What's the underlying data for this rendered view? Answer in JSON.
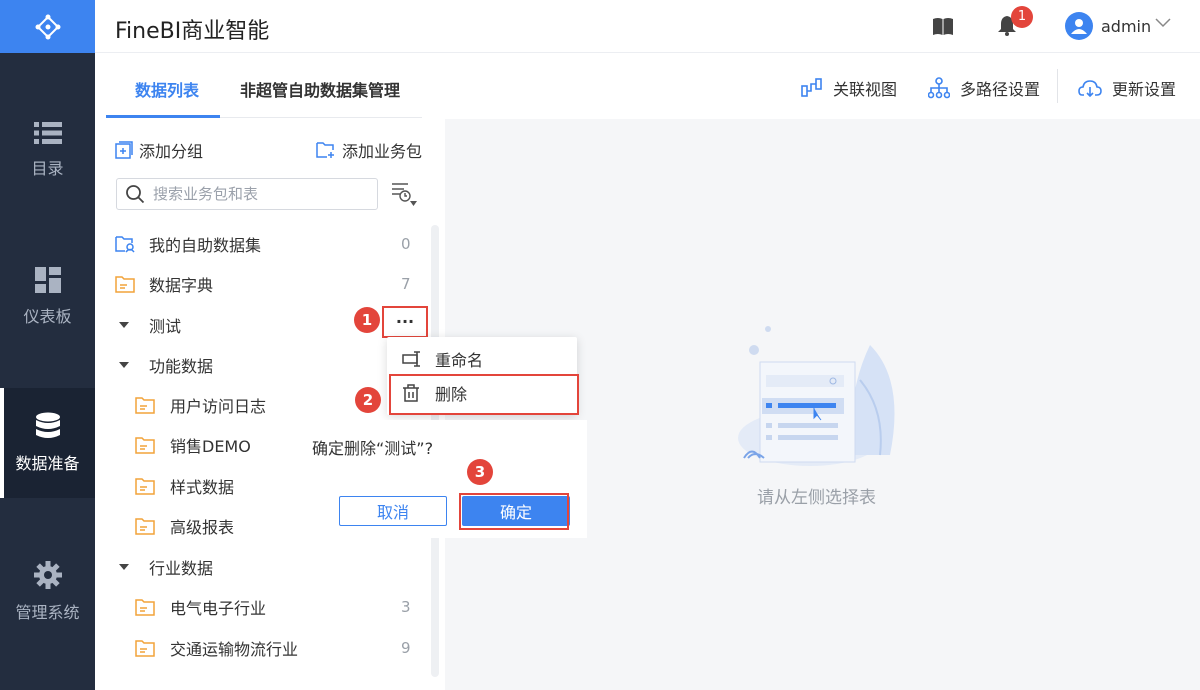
{
  "app": {
    "title": "FineBI商业智能"
  },
  "header": {
    "notification_count": "1",
    "username": "admin"
  },
  "nav": {
    "items": [
      {
        "label": "目录",
        "icon": "list-icon"
      },
      {
        "label": "仪表板",
        "icon": "dashboard-icon"
      },
      {
        "label": "数据准备",
        "icon": "database-icon",
        "active": true
      },
      {
        "label": "管理系统",
        "icon": "gear-icon"
      }
    ]
  },
  "tabs": [
    {
      "label": "数据列表",
      "active": true
    },
    {
      "label": "非超管自助数据集管理",
      "active": false
    }
  ],
  "toolbar": {
    "relation_view": "关联视图",
    "multipath": "多路径设置",
    "update_settings": "更新设置"
  },
  "panel": {
    "add_group": "添加分组",
    "add_package": "添加业务包",
    "search_placeholder": "搜索业务包和表"
  },
  "tree": [
    {
      "label": "我的自助数据集",
      "count": "0"
    },
    {
      "label": "数据字典",
      "count": "7"
    },
    {
      "label": "测试"
    },
    {
      "label": "功能数据"
    },
    {
      "label": "用户访问日志"
    },
    {
      "label": "销售DEMO"
    },
    {
      "label": "样式数据"
    },
    {
      "label": "高级报表"
    },
    {
      "label": "行业数据"
    },
    {
      "label": "电气电子行业",
      "count": "3"
    },
    {
      "label": "交通运输物流行业",
      "count": "9"
    }
  ],
  "more_button": "···",
  "context_menu": {
    "rename": "重命名",
    "delete": "删除"
  },
  "confirm": {
    "message": "确定删除“测试”?",
    "cancel": "取消",
    "ok": "确定"
  },
  "steps": [
    "1",
    "2",
    "3"
  ],
  "empty": {
    "text": "请从左侧选择表"
  },
  "colors": {
    "primary": "#3d84f0",
    "nav_bg": "#232d3f",
    "annotation": "#e3453b",
    "folder": "#f2a33a"
  }
}
